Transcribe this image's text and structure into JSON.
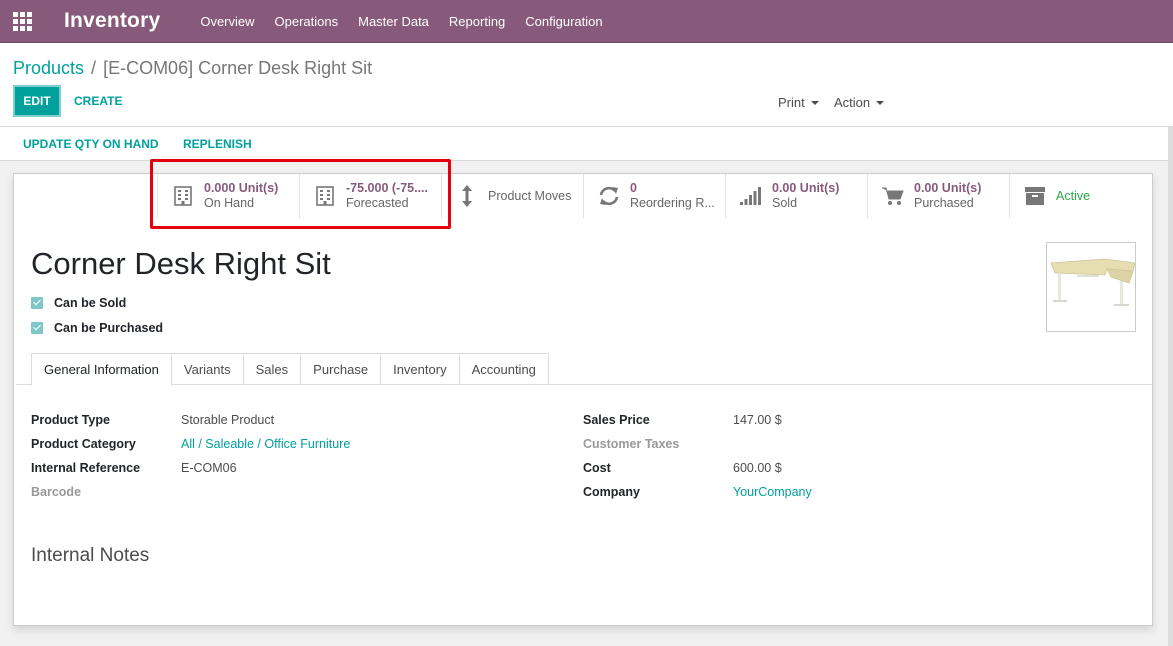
{
  "navbar": {
    "app_name": "Inventory",
    "menu": [
      "Overview",
      "Operations",
      "Master Data",
      "Reporting",
      "Configuration"
    ]
  },
  "breadcrumb": {
    "parent": "Products",
    "separator": "/",
    "current": "[E-COM06] Corner Desk Right Sit"
  },
  "actions": {
    "edit": "EDIT",
    "create": "CREATE",
    "print": "Print",
    "action": "Action"
  },
  "header_buttons": {
    "update_qty": "UPDATE QTY ON HAND",
    "replenish": "REPLENISH"
  },
  "smart_buttons": [
    {
      "icon": "building-icon",
      "value": "0.000 Unit(s)",
      "label": "On Hand"
    },
    {
      "icon": "building-icon",
      "value": "-75.000 (-75....",
      "label": "Forecasted"
    },
    {
      "icon": "arrows-v-icon",
      "label": "Product Moves"
    },
    {
      "icon": "refresh-icon",
      "value": "0",
      "label": "Reordering R..."
    },
    {
      "icon": "signal-icon",
      "value": "0.00 Unit(s)",
      "label": "Sold"
    },
    {
      "icon": "cart-icon",
      "value": "0.00 Unit(s)",
      "label": "Purchased"
    },
    {
      "icon": "archive-icon",
      "label": "Active"
    }
  ],
  "product": {
    "name": "Corner Desk Right Sit",
    "can_be_sold": "Can be Sold",
    "can_be_purchased": "Can be Purchased"
  },
  "tabs": [
    "General Information",
    "Variants",
    "Sales",
    "Purchase",
    "Inventory",
    "Accounting"
  ],
  "general_info": {
    "left": [
      {
        "label": "Product Type",
        "value": "Storable Product"
      },
      {
        "label": "Product Category",
        "value": "All / Saleable / Office Furniture"
      },
      {
        "label": "Internal Reference",
        "value": "E-COM06"
      },
      {
        "label": "Barcode",
        "value": ""
      }
    ],
    "right": [
      {
        "label": "Sales Price",
        "value": "147.00 $"
      },
      {
        "label": "Customer Taxes",
        "value": ""
      },
      {
        "label": "Cost",
        "value": "600.00 $"
      },
      {
        "label": "Company",
        "value": "YourCompany"
      }
    ]
  },
  "notes": {
    "title": "Internal Notes"
  },
  "colors": {
    "brand": "#875a7b",
    "accent": "#00a09d",
    "highlight": "#e5000b",
    "active": "#28a745"
  }
}
